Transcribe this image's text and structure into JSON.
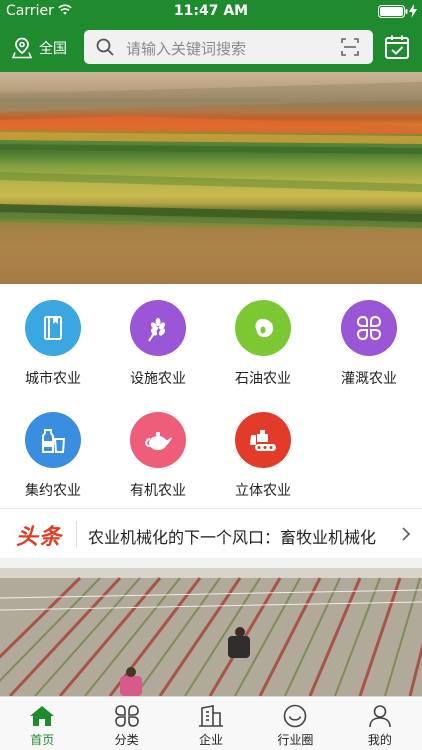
{
  "status_bar": {
    "carrier": "Carrier",
    "time": "11:47 AM"
  },
  "header": {
    "location": "全国",
    "search_placeholder": "请输入关键词搜索",
    "icons": [
      "location-pin-icon",
      "search-icon",
      "scan-icon",
      "calendar-check-icon"
    ]
  },
  "banner": {
    "slide_count": 3,
    "active_slide": 2
  },
  "categories": [
    {
      "label": "城市农业",
      "icon": "book-icon",
      "color": "#3aa7e0"
    },
    {
      "label": "设施农业",
      "icon": "wheat-icon",
      "color": "#9a56d6"
    },
    {
      "label": "石油农业",
      "icon": "bean-icon",
      "color": "#7cc832"
    },
    {
      "label": "灌溉农业",
      "icon": "clover-grid-icon",
      "color": "#9a56d6"
    },
    {
      "label": "集约农业",
      "icon": "bottle-cup-icon",
      "color": "#3a8ee0"
    },
    {
      "label": "有机农业",
      "icon": "teapot-icon",
      "color": "#ee5d7a"
    },
    {
      "label": "立体农业",
      "icon": "bulldozer-icon",
      "color": "#e23b2a"
    }
  ],
  "headline": {
    "tag": "头条",
    "text": "农业机械化的下一个风口：畜牧业机械化"
  },
  "tabbar": [
    {
      "label": "首页",
      "icon": "home-icon",
      "active": true
    },
    {
      "label": "分类",
      "icon": "category-icon",
      "active": false
    },
    {
      "label": "企业",
      "icon": "building-icon",
      "active": false
    },
    {
      "label": "行业圈",
      "icon": "smile-circle-icon",
      "active": false
    },
    {
      "label": "我的",
      "icon": "profile-icon",
      "active": false
    }
  ],
  "colors": {
    "brand_green": "#1f8a2e",
    "headline_red": "#e23b1f"
  }
}
